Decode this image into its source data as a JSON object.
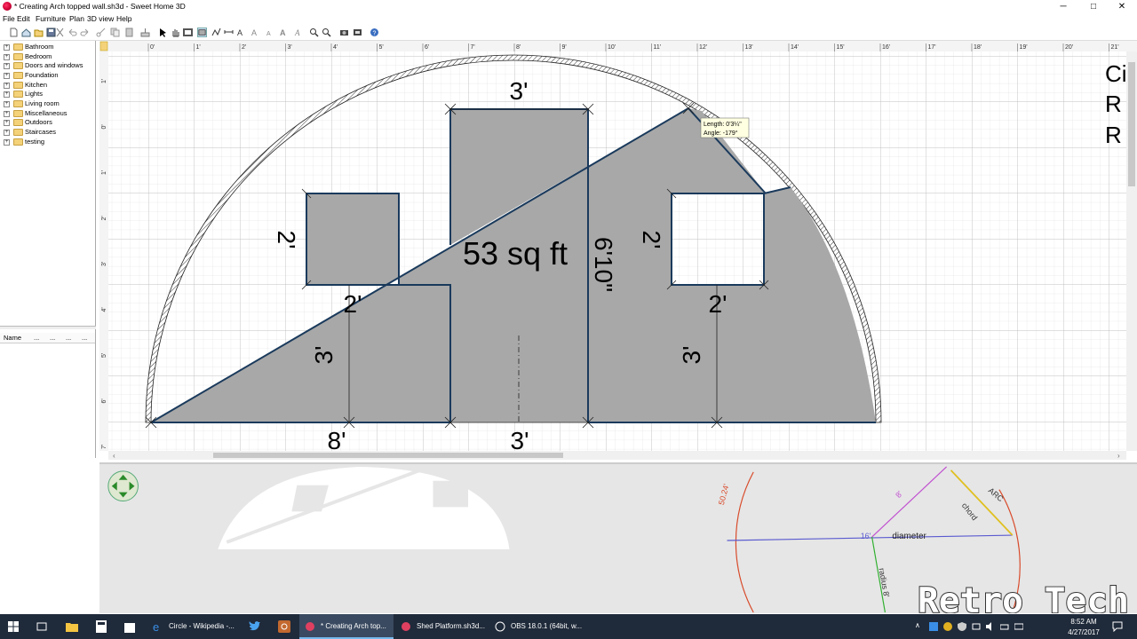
{
  "window": {
    "title": "* Creating Arch topped wall.sh3d - Sweet Home 3D",
    "minimize": "─",
    "maximize": "□",
    "close": "✕"
  },
  "menu": [
    "File",
    "Edit",
    "Furniture",
    "Plan",
    "3D view",
    "Help"
  ],
  "catalog": [
    "Bathroom",
    "Bedroom",
    "Doors and windows",
    "Foundation",
    "Kitchen",
    "Lights",
    "Living room",
    "Miscellaneous",
    "Outdoors",
    "Staircases",
    "testing"
  ],
  "furniture_columns": [
    "Name",
    "...",
    "...",
    "...",
    "..."
  ],
  "ruler_top": [
    "0'",
    "1'",
    "2'",
    "3'",
    "4'",
    "5'",
    "6'",
    "7'",
    "8'",
    "9'",
    "10'",
    "11'",
    "12'",
    "13'",
    "14'",
    "15'",
    "16'",
    "17'",
    "18'",
    "19'",
    "20'",
    "21'"
  ],
  "ruler_left": [
    "1'",
    "0'",
    "1'",
    "2'",
    "3'",
    "4'",
    "5'",
    "6'",
    "7'"
  ],
  "plan": {
    "room_area": "53 sq ft",
    "dims": {
      "top_window": "3'",
      "left_window_height": "2'",
      "left_window_width": "2'",
      "left_wall_height": "3'",
      "center_height": "6'10\"",
      "right_window_height": "2'",
      "right_window_width": "2'",
      "right_wall_height": "3'",
      "bottom_left": "8'",
      "bottom_center": "3'"
    },
    "tooltip": {
      "length": "Length: 0'3¼\"",
      "angle": "Angle: -179°"
    },
    "side_text": [
      "Ci",
      "R",
      "R"
    ]
  },
  "overlay": {
    "arc": "ARC",
    "chord": "chord",
    "diameter": "diameter",
    "sixteen": "16'",
    "eight_top": "8'",
    "radius": "radius 8'",
    "arc_len": "50.24'",
    "watermark": "Retro Tech"
  },
  "taskbar": {
    "items": [
      "Circle - Wikipedia -...",
      "* Creating Arch top...",
      "Shed Platform.sh3d...",
      "OBS 18.0.1 (64bit, w..."
    ],
    "time": "8:52 AM",
    "date": "4/27/2017"
  },
  "colors": {
    "wall_fill": "#a8a8a8",
    "wall_outline": "#1a3a5c",
    "taskbar": "#1f2a3a",
    "accent": "#76b9ed"
  }
}
